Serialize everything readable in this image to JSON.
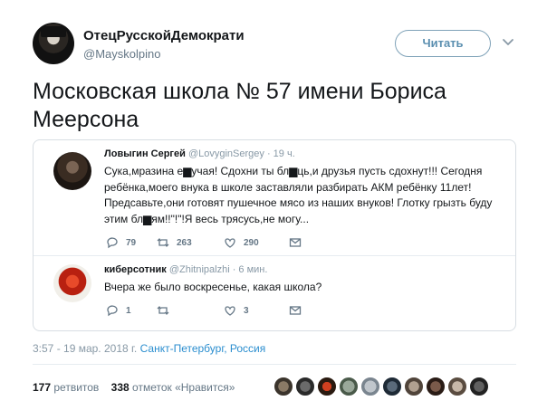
{
  "author": {
    "name": "ОтецРусскойДемократи",
    "handle": "@Mayskolpino",
    "follow_label": "Читать"
  },
  "tweet": {
    "text": "Московская школа № 57 имени Бориса Меерсона",
    "timestamp": "3:57 - 19 мар. 2018 г.",
    "place": "Санкт-Петербург, Россия"
  },
  "quoted": {
    "tweet1": {
      "name": "Ловыгин Сергей",
      "handle": "@LovyginSergey",
      "time": "· 19 ч.",
      "text": "Сука,мразина е▆учая! Сдохни ты бл▆ць,и друзья пусть сдохнут!!! Сегодня ребёнка,моего внука в школе заставляли разбирать АКМ ребёнку 11лет! Предсавьте,они готовят пушечное мясо из наших внуков! Глотку грызть буду этим бл▆ям!!\"!\"!Я весь трясусь,не могу...",
      "replies": "79",
      "retweets": "263",
      "likes": "290"
    },
    "tweet2": {
      "name": "киберсотник",
      "handle": "@Zhitnipalzhi",
      "time": "· 6 мин.",
      "text": "Вчера же было воскресенье, какая школа?",
      "replies": "1",
      "retweets": "",
      "likes": "3"
    }
  },
  "stats": {
    "retweets_count": "177",
    "retweets_label": "ретвитов",
    "likes_count": "338",
    "likes_label": "отметок «Нравится»"
  },
  "colors": {
    "link": "#2b8ecf",
    "muted": "#657786",
    "follow_border": "#7fa2b8"
  }
}
